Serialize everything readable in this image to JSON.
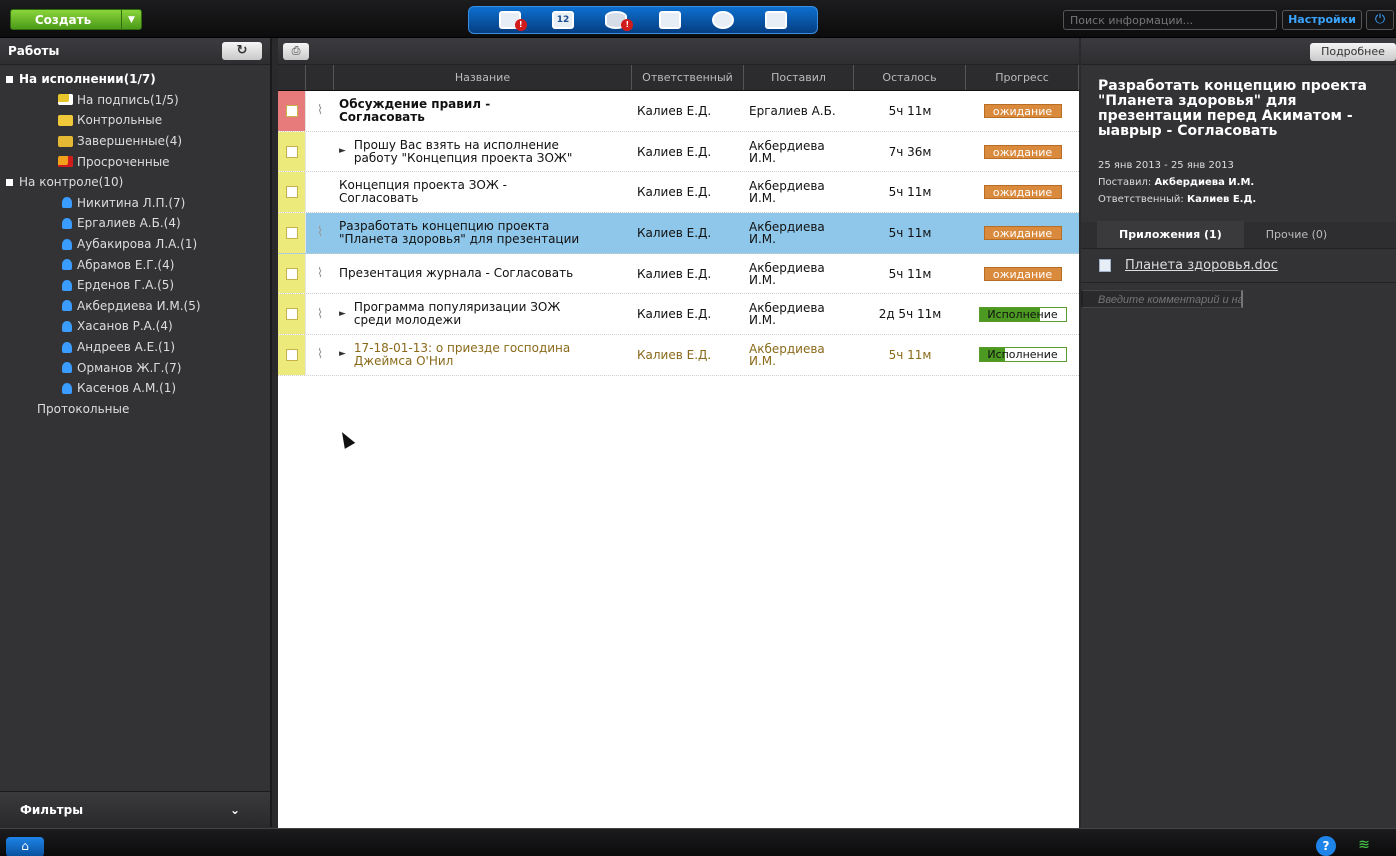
{
  "topbar": {
    "create_label": "Создать",
    "search_placeholder": "Поиск информации...",
    "settings_label": "Настройки",
    "module_badges": [
      "!",
      "12",
      "!"
    ]
  },
  "sidebar": {
    "title": "Работы",
    "tree": [
      {
        "label": "На исполнении(1/7)",
        "type": "group",
        "bold": true
      },
      {
        "label": "На подпись(1/5)",
        "type": "folder",
        "icon": "sign-folder-icon"
      },
      {
        "label": "Контрольные",
        "type": "folder",
        "icon": "control-folder-icon"
      },
      {
        "label": "Завершенные(4)",
        "type": "folder",
        "icon": "done-folder-icon"
      },
      {
        "label": "Просроченные",
        "type": "folder",
        "icon": "overdue-folder-icon"
      },
      {
        "label": "На контроле(10)",
        "type": "group",
        "bold": false
      },
      {
        "label": "Никитина Л.П.(7)",
        "type": "person"
      },
      {
        "label": "Ергалиев А.Б.(4)",
        "type": "person"
      },
      {
        "label": "Аубакирова Л.А.(1)",
        "type": "person"
      },
      {
        "label": "Абрамов Е.Г.(4)",
        "type": "person"
      },
      {
        "label": "Ерденов Г.А.(5)",
        "type": "person"
      },
      {
        "label": "Акбердиева И.М.(5)",
        "type": "person"
      },
      {
        "label": "Хасанов Р.А.(4)",
        "type": "person"
      },
      {
        "label": "Андреев А.Е.(1)",
        "type": "person"
      },
      {
        "label": "Орманов Ж.Г.(7)",
        "type": "person"
      },
      {
        "label": "Касенов А.М.(1)",
        "type": "person"
      },
      {
        "label": "Протокольные",
        "type": "plain"
      }
    ],
    "filters_label": "Фильтры"
  },
  "table": {
    "columns": [
      "Название",
      "Ответственный",
      "Поставил",
      "Осталось",
      "Прогресс"
    ],
    "rows": [
      {
        "name": "Обсуждение правил -\nСогласовать",
        "bold": true,
        "resp": "Калиев Е.Д.",
        "by": "Ергалиев А.Б.",
        "left": "5ч 11м",
        "status": "ожидание",
        "status_type": "wait",
        "marker": "#e77b7b",
        "clip": true,
        "tri": false
      },
      {
        "name": "Прошу Вас взять на исполнение\nработу \"Концепция проекта ЗОЖ\"",
        "bold": false,
        "resp": "Калиев Е.Д.",
        "by": "Акбердиева\nИ.М.",
        "left": "7ч 36м",
        "status": "ожидание",
        "status_type": "wait",
        "marker": "#ecea7a",
        "clip": false,
        "tri": true
      },
      {
        "name": "Концепция проекта ЗОЖ -\nСогласовать",
        "bold": false,
        "resp": "Калиев Е.Д.",
        "by": "Акбердиева\nИ.М.",
        "left": "5ч 11м",
        "status": "ожидание",
        "status_type": "wait",
        "marker": "#ecea7a",
        "clip": false,
        "tri": false
      },
      {
        "name": "Разработать концепцию проекта\n\"Планета здоровья\" для презентации",
        "bold": false,
        "resp": "Калиев Е.Д.",
        "by": "Акбердиева\nИ.М.",
        "left": "5ч 11м",
        "status": "ожидание",
        "status_type": "wait",
        "marker": "#ecea7a",
        "clip": true,
        "tri": false,
        "selected": true
      },
      {
        "name": "Презентация журнала - Согласовать",
        "bold": false,
        "resp": "Калиев Е.Д.",
        "by": "Акбердиева\nИ.М.",
        "left": "5ч 11м",
        "status": "ожидание",
        "status_type": "wait",
        "marker": "#ecea7a",
        "clip": true,
        "tri": false
      },
      {
        "name": "Программа популяризации ЗОЖ\nсреди молодежи",
        "bold": false,
        "resp": "Калиев Е.Д.",
        "by": "Акбердиева\nИ.М.",
        "left": "2д 5ч 11м",
        "status": "Исполнение",
        "status_type": "exec",
        "progress": 0.7,
        "marker": "#ecea7a",
        "clip": true,
        "tri": true
      },
      {
        "name": "17-18-01-13: о приезде господина\nДжеймса О'Нил",
        "bold": false,
        "resp": "Калиев Е.Д.",
        "by": "Акбердиева\nИ.М.",
        "left": "5ч 11м",
        "status": "Исполнение",
        "status_type": "exec",
        "progress": 0.3,
        "marker": "#ecea7a",
        "clip": true,
        "tri": true,
        "olive": true
      }
    ]
  },
  "detail": {
    "more_label": "Подробнее",
    "title": "Разработать концепцию проекта \"Планета здоровья\" для презентации перед Акиматом - ыаврыр - Согласовать",
    "dates": "25 янв 2013 - 25 янв 2013",
    "by_label": "Поставил:",
    "by_value": "Акбердиева И.М.",
    "resp_label": "Ответственный:",
    "resp_value": "Калиев Е.Д.",
    "tab_attachments": "Приложения (1)",
    "tab_other": "Прочие (0)",
    "attachment": "Планета здоровья.doc",
    "comment_placeholder": "Введите комментарий и нажмите Enter..."
  },
  "bottombar": {
    "help_label": "?"
  },
  "colors": {
    "accent": "#1e84e8",
    "create_green": "#6cc02a",
    "wait": "#d98a3d",
    "exec": "#4c9a22",
    "selected_row": "#8fc7ea"
  }
}
